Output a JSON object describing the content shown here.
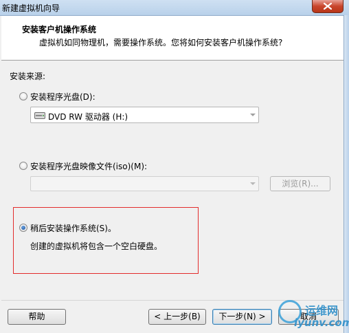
{
  "window": {
    "title": "新建虚拟机向导"
  },
  "header": {
    "title": "安装客户机操作系统",
    "subtitle": "虚拟机如同物理机，需要操作系统。您将如何安装客户机操作系统?"
  },
  "install_source": {
    "label": "安装来源:",
    "options": [
      {
        "label": "安装程序光盘(D):",
        "checked": false
      },
      {
        "label": "安装程序光盘映像文件(iso)(M):",
        "checked": false
      },
      {
        "label": "稍后安装操作系统(S)。",
        "checked": true
      }
    ],
    "disc_drive": {
      "value": "DVD RW 驱动器 (H:)",
      "icon": "dvd-drive-icon"
    },
    "iso_path": {
      "value": ""
    },
    "browse_label": "浏览(R)...",
    "later_description": "创建的虚拟机将包含一个空白硬盘。"
  },
  "footer": {
    "help_label": "帮助",
    "back_label": "< 上一步(B)",
    "next_label": "下一步(N) >",
    "cancel_label": "取消"
  },
  "watermark": {
    "top": "运维网",
    "bottom": "iyunv.com"
  },
  "colors": {
    "highlight_border": "#e32b2b",
    "titlebar": "#b9d1ea",
    "close_button": "#c9462c"
  }
}
